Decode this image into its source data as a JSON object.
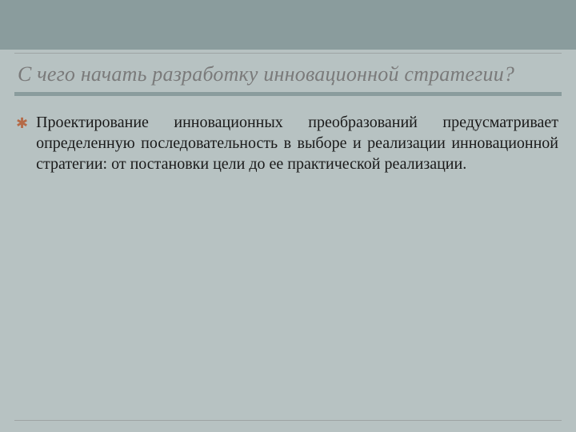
{
  "title": "С чего начать разработку инновационной стратегии?",
  "bullets": [
    "Проектирование инновационных преобразований предусматривает определенную последовательность в выборе и реализации инновационной стратегии: от постановки цели до ее практической реализации."
  ]
}
